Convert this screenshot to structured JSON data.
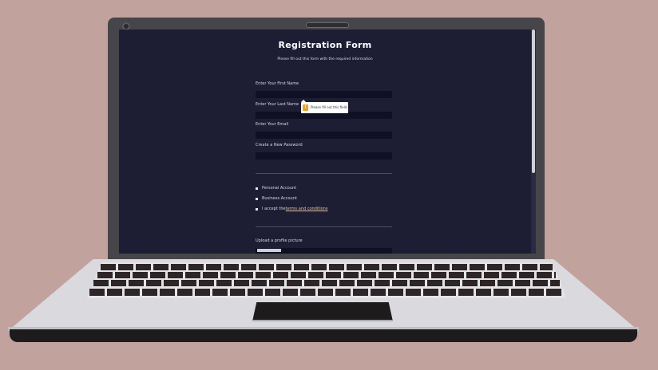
{
  "form": {
    "title": "Registration Form",
    "subtitle": "Please fill out this form with the required information",
    "fields": [
      {
        "label": "Enter Your First Name",
        "value": ""
      },
      {
        "label": "Enter Your Last Name",
        "value": ""
      },
      {
        "label": "Enter Your Email",
        "value": ""
      },
      {
        "label": "Create a New Password",
        "value": ""
      }
    ],
    "tooltip": {
      "badge": "!",
      "text": "Please fill out this field."
    },
    "account_type": [
      {
        "label": "Personal Account"
      },
      {
        "label": "Business Account"
      }
    ],
    "terms": {
      "prefix": "I accept the ",
      "link": "terms and conditions"
    },
    "upload": {
      "label": "Upload a profile picture"
    }
  },
  "colors": {
    "page_bg": "#c1a29d",
    "screen_bg": "#1d1e33",
    "input_bg": "#0f1023",
    "accent": "#f0a020",
    "link": "#e8c4a0"
  }
}
